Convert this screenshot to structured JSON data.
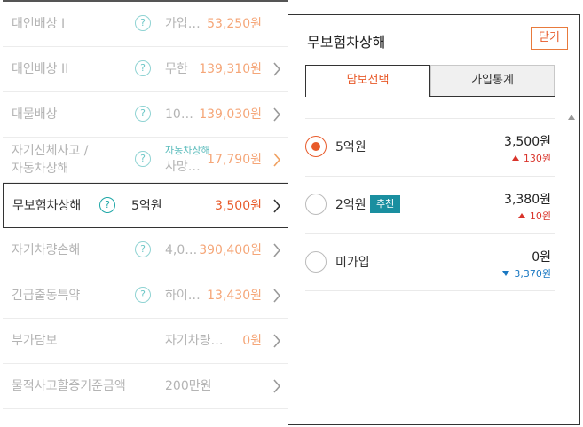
{
  "coverages": [
    {
      "name": "대인배상 I",
      "value": "가입…",
      "price": "53,250원",
      "chevron": false
    },
    {
      "name": "대인배상 II",
      "value": "무한",
      "price": "139,310원",
      "chevron": true
    },
    {
      "name": "대물배상",
      "value": "10…",
      "price": "139,030원",
      "chevron": true
    },
    {
      "name_line1": "자기신체사고 /",
      "name_line2": "자동차상해",
      "value_line1": "자동차상해",
      "value_line2": "사망…",
      "price": "17,790원",
      "chevron": true
    },
    {
      "name": "무보험차상해",
      "value": "5억원",
      "price": "3,500원",
      "chevron": true
    },
    {
      "name": "자기차량손해",
      "value": "4,0…",
      "price": "390,400원",
      "chevron": true
    },
    {
      "name": "긴급출동특약",
      "value": "하이…",
      "price": "13,430원",
      "chevron": true
    },
    {
      "name": "부가담보",
      "value": "자기차량…",
      "price": "0원",
      "chevron": true
    },
    {
      "name": "물적사고할증기준금액",
      "value": "200만원",
      "price": "",
      "chevron": true
    }
  ],
  "help_glyph": "?",
  "panel": {
    "title": "무보험차상해",
    "close_label": "닫기",
    "tabs": [
      "담보선택",
      "가입통계"
    ],
    "options": [
      {
        "label": "5억원",
        "badge": "",
        "amount": "3,500원",
        "diff": "130원",
        "direction": "up",
        "selected": true
      },
      {
        "label": "2억원",
        "badge": "추천",
        "amount": "3,380원",
        "diff": "10원",
        "direction": "up",
        "selected": false
      },
      {
        "label": "미가입",
        "badge": "",
        "amount": "0원",
        "diff": "3,370원",
        "direction": "down",
        "selected": false
      }
    ]
  },
  "colors": {
    "accent": "#e85a2a",
    "price": "#f5a678",
    "teal": "#1a8fa0",
    "up": "#d9342b",
    "down": "#1a78c2"
  }
}
